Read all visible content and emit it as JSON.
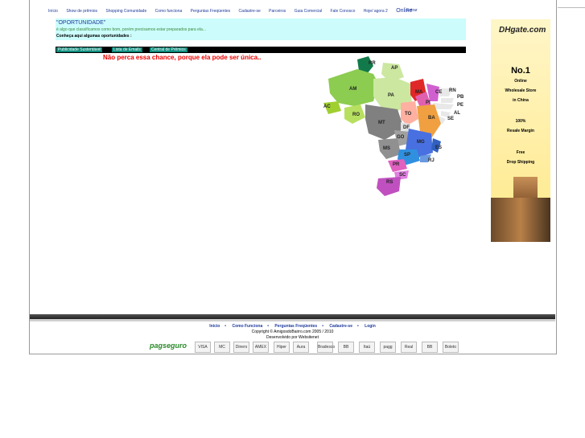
{
  "nav": {
    "items": [
      "Início",
      "Show de prêmios",
      "Shopping Comunidade",
      "Como funciona",
      "Perguntas Freqüentes",
      "Cadastre-se",
      "Parceiros",
      "Guia Comercial",
      "Fale Conosco"
    ],
    "online_prefix": "Hoje/ agora 2",
    "online_label": "Online",
    "login": "Entrar"
  },
  "banner": {
    "heading": "\"OPORTUNIDADE\"",
    "subtitle": "é algo que classificamos como bom, porém precisamos estar preparados para ela...",
    "cta": "Conheça aqui algumas oportunidades :"
  },
  "tabs": [
    "Publicidade Sustentável",
    "Lista de Emails",
    "Central de Prêmios"
  ],
  "headline": "Não perca essa chance, porque ela pode ser única..",
  "map": {
    "states": [
      "RR",
      "AP",
      "AM",
      "PA",
      "MA",
      "CE",
      "RN",
      "PB",
      "PE",
      "AL",
      "SE",
      "PI",
      "AC",
      "RO",
      "TO",
      "BA",
      "MT",
      "DF",
      "GO",
      "MG",
      "ES",
      "MS",
      "SP",
      "RJ",
      "PR",
      "SC",
      "RS"
    ]
  },
  "ad": {
    "brand": "DHgate.com",
    "line1": "No.1",
    "line2": "Online",
    "line3": "Wholesale Store",
    "line4": "in China",
    "line5": "100%",
    "line6": "Resale Margin",
    "line7": "Free",
    "line8": "Drop Shipping"
  },
  "footer": {
    "links": [
      "Início",
      "Como Funciona",
      "Perguntas Freqüentes",
      "Cadastre-se",
      "Login"
    ],
    "separator": "•",
    "copyright": "Copyright © AmigosdoBairro.com 2005 / 2010",
    "developed": "Desenvolvido por Websitenet",
    "payment_brand": "pagseguro",
    "payment_icons": [
      "VISA",
      "MC",
      "Diners",
      "AMEX",
      "Hiper",
      "Aura",
      "Bradesco",
      "BB",
      "Itaú",
      "pagg",
      "Real",
      "BB",
      "Boleto"
    ]
  }
}
